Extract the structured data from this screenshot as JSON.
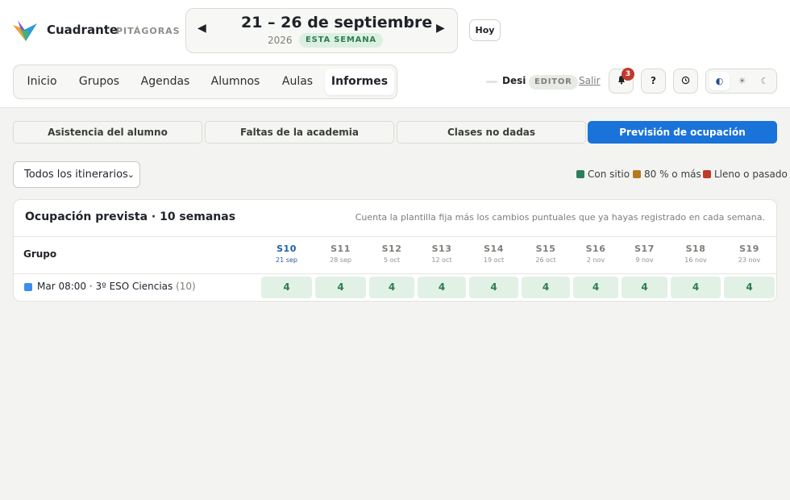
{
  "app": {
    "name": "Cuadrante",
    "school": "PITÁGORAS"
  },
  "week": {
    "prev_icon": "chevron-left-icon",
    "next_icon": "chevron-right-icon",
    "title": "21 – 26 de septiembre",
    "year": "2026",
    "badge": "ESTA SEMANA",
    "chevron": "⌄"
  },
  "today_label": "Hoy",
  "nav": {
    "items": [
      "Inicio",
      "Grupos",
      "Agendas",
      "Alumnos",
      "Aulas",
      "Informes"
    ],
    "active": "Informes"
  },
  "user": {
    "name": "Desi",
    "role": "EDITOR",
    "logout": "Salir"
  },
  "notifications": {
    "count": "3",
    "icon": "bell-icon"
  },
  "help_label": "?",
  "history_icon": "clock-icon",
  "theme": {
    "options": [
      "auto-theme-icon",
      "sun-icon",
      "moon-icon"
    ],
    "active": "auto-theme-icon"
  },
  "report_tabs": [
    "Asistencia del alumno",
    "Faltas de la academia",
    "Clases no dadas",
    "Previsión de ocupación"
  ],
  "active_report_tab": "Previsión de ocupación",
  "filter": {
    "selected": "Todos los itinerarios"
  },
  "legend": [
    {
      "label": "Con sitio",
      "color": "#2e7d5b"
    },
    {
      "label": "80 % o más",
      "color": "#b7791f"
    },
    {
      "label": "Lleno o pasado",
      "color": "#c0392b"
    }
  ],
  "card": {
    "title": "Ocupación prevista · 10 semanas",
    "note": "Cuenta la plantilla fija más los cambios puntuales que ya hayas registrado en cada semana.",
    "group_header": "Grupo"
  },
  "weeks": [
    {
      "code": "S10",
      "date": "21 sep"
    },
    {
      "code": "S11",
      "date": "28 sep"
    },
    {
      "code": "S12",
      "date": "5 oct"
    },
    {
      "code": "S13",
      "date": "12 oct"
    },
    {
      "code": "S14",
      "date": "19 oct"
    },
    {
      "code": "S15",
      "date": "26 oct"
    },
    {
      "code": "S16",
      "date": "2 nov"
    },
    {
      "code": "S17",
      "date": "9 nov"
    },
    {
      "code": "S18",
      "date": "16 nov"
    },
    {
      "code": "S19",
      "date": "23 nov"
    }
  ],
  "current_week": "S10",
  "rows": [
    {
      "group": "Mar 08:00 · 3º ESO Ciencias",
      "capacity": "(10)",
      "color": "#3b8ef0",
      "values": [
        "4",
        "4",
        "4",
        "4",
        "4",
        "4",
        "4",
        "4",
        "4",
        "4"
      ]
    }
  ]
}
